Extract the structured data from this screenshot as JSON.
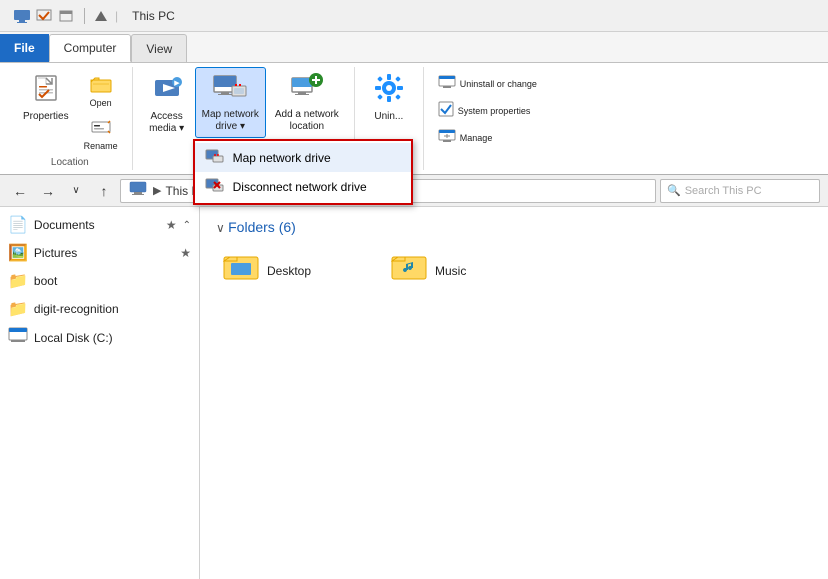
{
  "titleBar": {
    "title": "This PC",
    "quickAccessIcons": [
      "monitor-icon",
      "check-icon",
      "window-icon"
    ]
  },
  "ribbon": {
    "tabs": [
      {
        "id": "file",
        "label": "File",
        "active": false,
        "style": "file"
      },
      {
        "id": "computer",
        "label": "Computer",
        "active": true,
        "style": "active"
      },
      {
        "id": "view",
        "label": "View",
        "active": false,
        "style": "normal"
      }
    ],
    "groups": [
      {
        "id": "properties-group",
        "label": "Location",
        "buttons": [
          {
            "id": "properties-btn",
            "label": "Properties",
            "icon": "🗒️"
          },
          {
            "id": "open-btn",
            "label": "Open",
            "icon": "📂"
          },
          {
            "id": "rename-btn",
            "label": "Rename",
            "icon": "✏️"
          }
        ]
      },
      {
        "id": "network-group",
        "label": "",
        "buttons": [
          {
            "id": "access-media-btn",
            "label": "Access\nmedia ▾",
            "icon": "📡"
          },
          {
            "id": "map-drive-btn",
            "label": "Map network\ndrive ▾",
            "icon": "🖧",
            "highlighted": true
          },
          {
            "id": "add-network-btn",
            "label": "Add a network\nlocation",
            "icon": "🖥️"
          }
        ]
      },
      {
        "id": "settings-group",
        "label": "",
        "buttons": [
          {
            "id": "open-settings-btn",
            "label": "Open\nSettings",
            "icon": "⚙️"
          }
        ]
      },
      {
        "id": "system-group",
        "label": "",
        "buttons": [
          {
            "id": "uninstall-btn",
            "label": "Unin...",
            "icon": "🖥"
          },
          {
            "id": "system-btn",
            "label": "Syst...",
            "icon": "☑"
          },
          {
            "id": "manage-btn",
            "label": "Man...",
            "icon": "🖥"
          }
        ]
      }
    ],
    "dropdown": {
      "visible": true,
      "items": [
        {
          "id": "map-drive-item",
          "label": "Map network drive",
          "icon": "🖧",
          "highlighted": true
        },
        {
          "id": "disconnect-item",
          "label": "Disconnect network drive",
          "icon": "❌",
          "highlighted": false
        }
      ]
    }
  },
  "navBar": {
    "backLabel": "←",
    "forwardLabel": "→",
    "downLabel": "∨",
    "upLabel": "↑",
    "addressParts": [
      "This PC"
    ],
    "addressText": "This PC",
    "searchPlaceholder": "Search This PC"
  },
  "sidebar": {
    "items": [
      {
        "id": "documents",
        "label": "Documents",
        "icon": "📄",
        "pin": "★",
        "hasExpand": false
      },
      {
        "id": "pictures",
        "label": "Pictures",
        "icon": "🖼️",
        "pin": "★",
        "hasExpand": false
      },
      {
        "id": "boot",
        "label": "boot",
        "icon": "📁",
        "pin": "",
        "hasExpand": false
      },
      {
        "id": "digit-recognition",
        "label": "digit-recognition",
        "icon": "📁",
        "pin": "",
        "hasExpand": false
      },
      {
        "id": "local-disk",
        "label": "Local Disk (C:)",
        "icon": "💻",
        "pin": "",
        "hasExpand": false
      }
    ]
  },
  "content": {
    "sectionTitle": "Folders (6)",
    "folders": [
      {
        "id": "desktop",
        "label": "Desktop",
        "icon": "desktop"
      },
      {
        "id": "music",
        "label": "Music",
        "icon": "music"
      }
    ]
  }
}
